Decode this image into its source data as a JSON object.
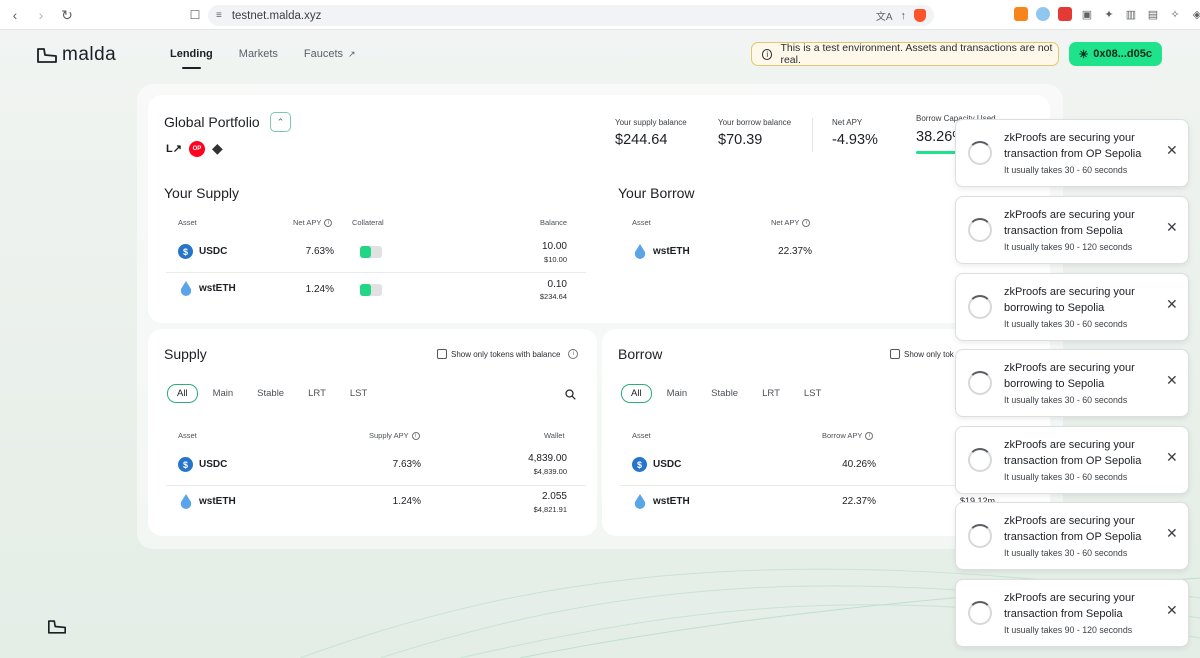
{
  "browser": {
    "url": "testnet.malda.xyz"
  },
  "header": {
    "brand": "malda",
    "nav": [
      {
        "label": "Lending"
      },
      {
        "label": "Markets"
      },
      {
        "label": "Faucets"
      }
    ],
    "test_notice": "This is a test environment. Assets and transactions are not real.",
    "wallet": "0x08...d05c"
  },
  "portfolio": {
    "title": "Global Portfolio",
    "networks": [
      "icon-l",
      "OP",
      "ethereum"
    ],
    "stats": [
      {
        "label": "Your supply balance",
        "value": "$244.64"
      },
      {
        "label": "Your borrow balance",
        "value": "$70.39"
      },
      {
        "label": "Net APY",
        "value": "-4.93%"
      },
      {
        "label": "Borrow Capacity Used",
        "value": "38.26%"
      }
    ],
    "your_supply": {
      "title": "Your Supply",
      "headers": {
        "asset": "Asset",
        "apy": "Net APY",
        "collateral": "Collateral",
        "balance": "Balance"
      },
      "rows": [
        {
          "asset": "USDC",
          "apy": "7.63%",
          "balance": "10.00",
          "balance_usd": "$10.00",
          "collateral": true
        },
        {
          "asset": "wstETH",
          "apy": "1.24%",
          "balance": "0.10",
          "balance_usd": "$234.64",
          "collateral": true
        }
      ]
    },
    "your_borrow": {
      "title": "Your Borrow",
      "headers": {
        "asset": "Asset",
        "apy": "Net APY"
      },
      "rows": [
        {
          "asset": "wstETH",
          "apy": "22.37%"
        }
      ]
    }
  },
  "supply": {
    "title": "Supply",
    "filter_label": "Show only tokens with balance",
    "tabs": [
      "All",
      "Main",
      "Stable",
      "LRT",
      "LST"
    ],
    "headers": {
      "asset": "Asset",
      "apy": "Supply APY",
      "wallet": "Wallet"
    },
    "rows": [
      {
        "asset": "USDC",
        "apy": "7.63%",
        "wallet": "4,839.00",
        "wallet_usd": "$4,839.00"
      },
      {
        "asset": "wstETH",
        "apy": "1.24%",
        "wallet": "2.055",
        "wallet_usd": "$4,821.91"
      }
    ]
  },
  "borrow": {
    "title": "Borrow",
    "filter_label": "Show only tok",
    "tabs": [
      "All",
      "Main",
      "Stable",
      "LRT",
      "LST"
    ],
    "headers": {
      "asset": "Asset",
      "apy": "Borrow APY"
    },
    "rows": [
      {
        "asset": "USDC",
        "apy": "40.26%"
      },
      {
        "asset": "wstETH",
        "apy": "22.37%",
        "peek": "$19.12m"
      }
    ]
  },
  "toasts": [
    {
      "title": "zkProofs are securing your transaction from OP Sepolia",
      "sub": "It usually takes 30 - 60 seconds"
    },
    {
      "title": "zkProofs are securing your transaction from Sepolia",
      "sub": "It usually takes 90 - 120 seconds"
    },
    {
      "title": "zkProofs are securing your borrowing to Sepolia",
      "sub": "It usually takes 30 - 60 seconds"
    },
    {
      "title": "zkProofs are securing your borrowing to Sepolia",
      "sub": "It usually takes 30 - 60 seconds"
    },
    {
      "title": "zkProofs are securing your transaction from OP Sepolia",
      "sub": "It usually takes 30 - 60 seconds"
    },
    {
      "title": "zkProofs are securing your transaction from OP Sepolia",
      "sub": "It usually takes 30 - 60 seconds"
    },
    {
      "title": "zkProofs are securing your transaction from Sepolia",
      "sub": "It usually takes 90 - 120 seconds"
    }
  ],
  "colors": {
    "accent": "#1ee38a",
    "notice_border": "#e2c76a",
    "usdc": "#2775ca",
    "op_red": "#ff0420"
  }
}
